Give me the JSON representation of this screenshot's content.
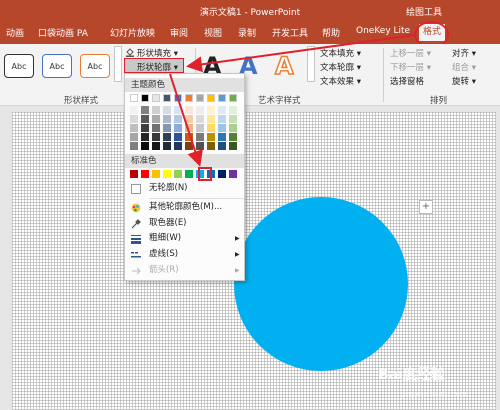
{
  "titlebar": {
    "title": "演示文稿1 - PowerPoint",
    "context_label": "绘图工具"
  },
  "tabs": [
    "动画",
    "口袋动画 PA",
    "幻灯片放映",
    "审阅",
    "视图",
    "录制",
    "开发工具",
    "帮助",
    "OneKey Lite"
  ],
  "active_tab": "格式",
  "ribbon": {
    "shape_style_sample": "Abc",
    "shape_fill": "形状填充 ▾",
    "shape_outline": "形状轮廓 ▾",
    "group_shape_styles": "形状样式",
    "wordart_letter": "A",
    "text_fill": "文本填充 ▾",
    "text_outline": "文本轮廓 ▾",
    "text_effects": "文本效果 ▾",
    "group_wordart": "艺术字样式",
    "bring_forward": "上移一层 ▾",
    "send_backward": "下移一层 ▾",
    "selection_pane": "选择窗格",
    "align": "对齐 ▾",
    "group": "组合 ▾",
    "rotate": "旋转 ▾",
    "group_arrange": "排列"
  },
  "menu": {
    "theme_colors_header": "主题颜色",
    "standard_colors_header": "标准色",
    "no_outline": "无轮廓(N)",
    "more_colors": "其他轮廓颜色(M)...",
    "eyedropper": "取色器(E)",
    "weight": "粗细(W)",
    "dashes": "虚线(S)",
    "arrows": "箭头(R)",
    "theme_top_row": [
      "#ffffff",
      "#000000",
      "#e7e6e6",
      "#44546a",
      "#4472c4",
      "#ed7d31",
      "#a5a5a5",
      "#ffc000",
      "#5b9bd5",
      "#70ad47"
    ],
    "theme_shades": [
      [
        "#f2f2f2",
        "#808080",
        "#d0cece",
        "#d6dce4",
        "#dae3f3",
        "#fbe5d6",
        "#ededed",
        "#fff2cc",
        "#deebf7",
        "#e2f0d9"
      ],
      [
        "#d9d9d9",
        "#595959",
        "#aeabab",
        "#adb9ca",
        "#b4c7e7",
        "#f8cbad",
        "#dbdbdb",
        "#ffe699",
        "#bdd7ee",
        "#c5e0b4"
      ],
      [
        "#bfbfbf",
        "#404040",
        "#757171",
        "#8497b0",
        "#8faadc",
        "#f4b183",
        "#c9c9c9",
        "#ffd966",
        "#9dc3e6",
        "#a9d18e"
      ],
      [
        "#a6a6a6",
        "#262626",
        "#3a3838",
        "#333f50",
        "#2f5597",
        "#c55a11",
        "#7b7b7b",
        "#bf9000",
        "#2e75b6",
        "#548235"
      ],
      [
        "#7f7f7f",
        "#0d0d0d",
        "#171717",
        "#222a35",
        "#1f3864",
        "#843c0c",
        "#525252",
        "#7f6000",
        "#1f4e79",
        "#385723"
      ]
    ],
    "standard_colors": [
      "#c00000",
      "#ff0000",
      "#ffc000",
      "#ffff00",
      "#92d050",
      "#00b050",
      "#00b0f0",
      "#0070c0",
      "#002060",
      "#7030a0"
    ]
  },
  "colors": {
    "titlebar": "#b7472a",
    "circle": "#00b0f0",
    "highlight": "#e0202a"
  },
  "watermark": {
    "main": "Bai度经验",
    "sub": "jingyan.baidu.com"
  }
}
